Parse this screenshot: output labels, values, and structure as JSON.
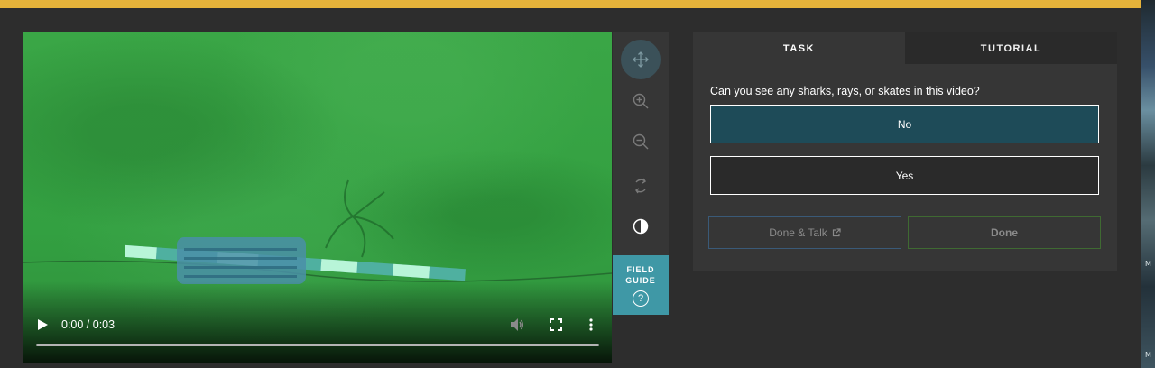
{
  "video": {
    "time": "0:00 / 0:03",
    "progress": 0
  },
  "toolbar": {
    "icons": [
      "move-icon",
      "zoom-in-icon",
      "zoom-out-icon",
      "rotate-icon",
      "invert-icon"
    ],
    "field_guide_label": "FIELD\nGUIDE",
    "field_guide_help": "?"
  },
  "task_panel": {
    "tabs": [
      {
        "label": "TASK",
        "selected": true
      },
      {
        "label": "TUTORIAL",
        "selected": false
      }
    ],
    "question": "Can you see any sharks, rays, or skates in this video?",
    "answers": [
      {
        "label": "No",
        "selected": true
      },
      {
        "label": "Yes",
        "selected": false
      }
    ],
    "done_talk_label": "Done & Talk",
    "done_label": "Done"
  },
  "colors": {
    "top_bar": "#e6b33a",
    "accent_teal": "#3f98a6",
    "selected_answer": "#1e4b58"
  }
}
